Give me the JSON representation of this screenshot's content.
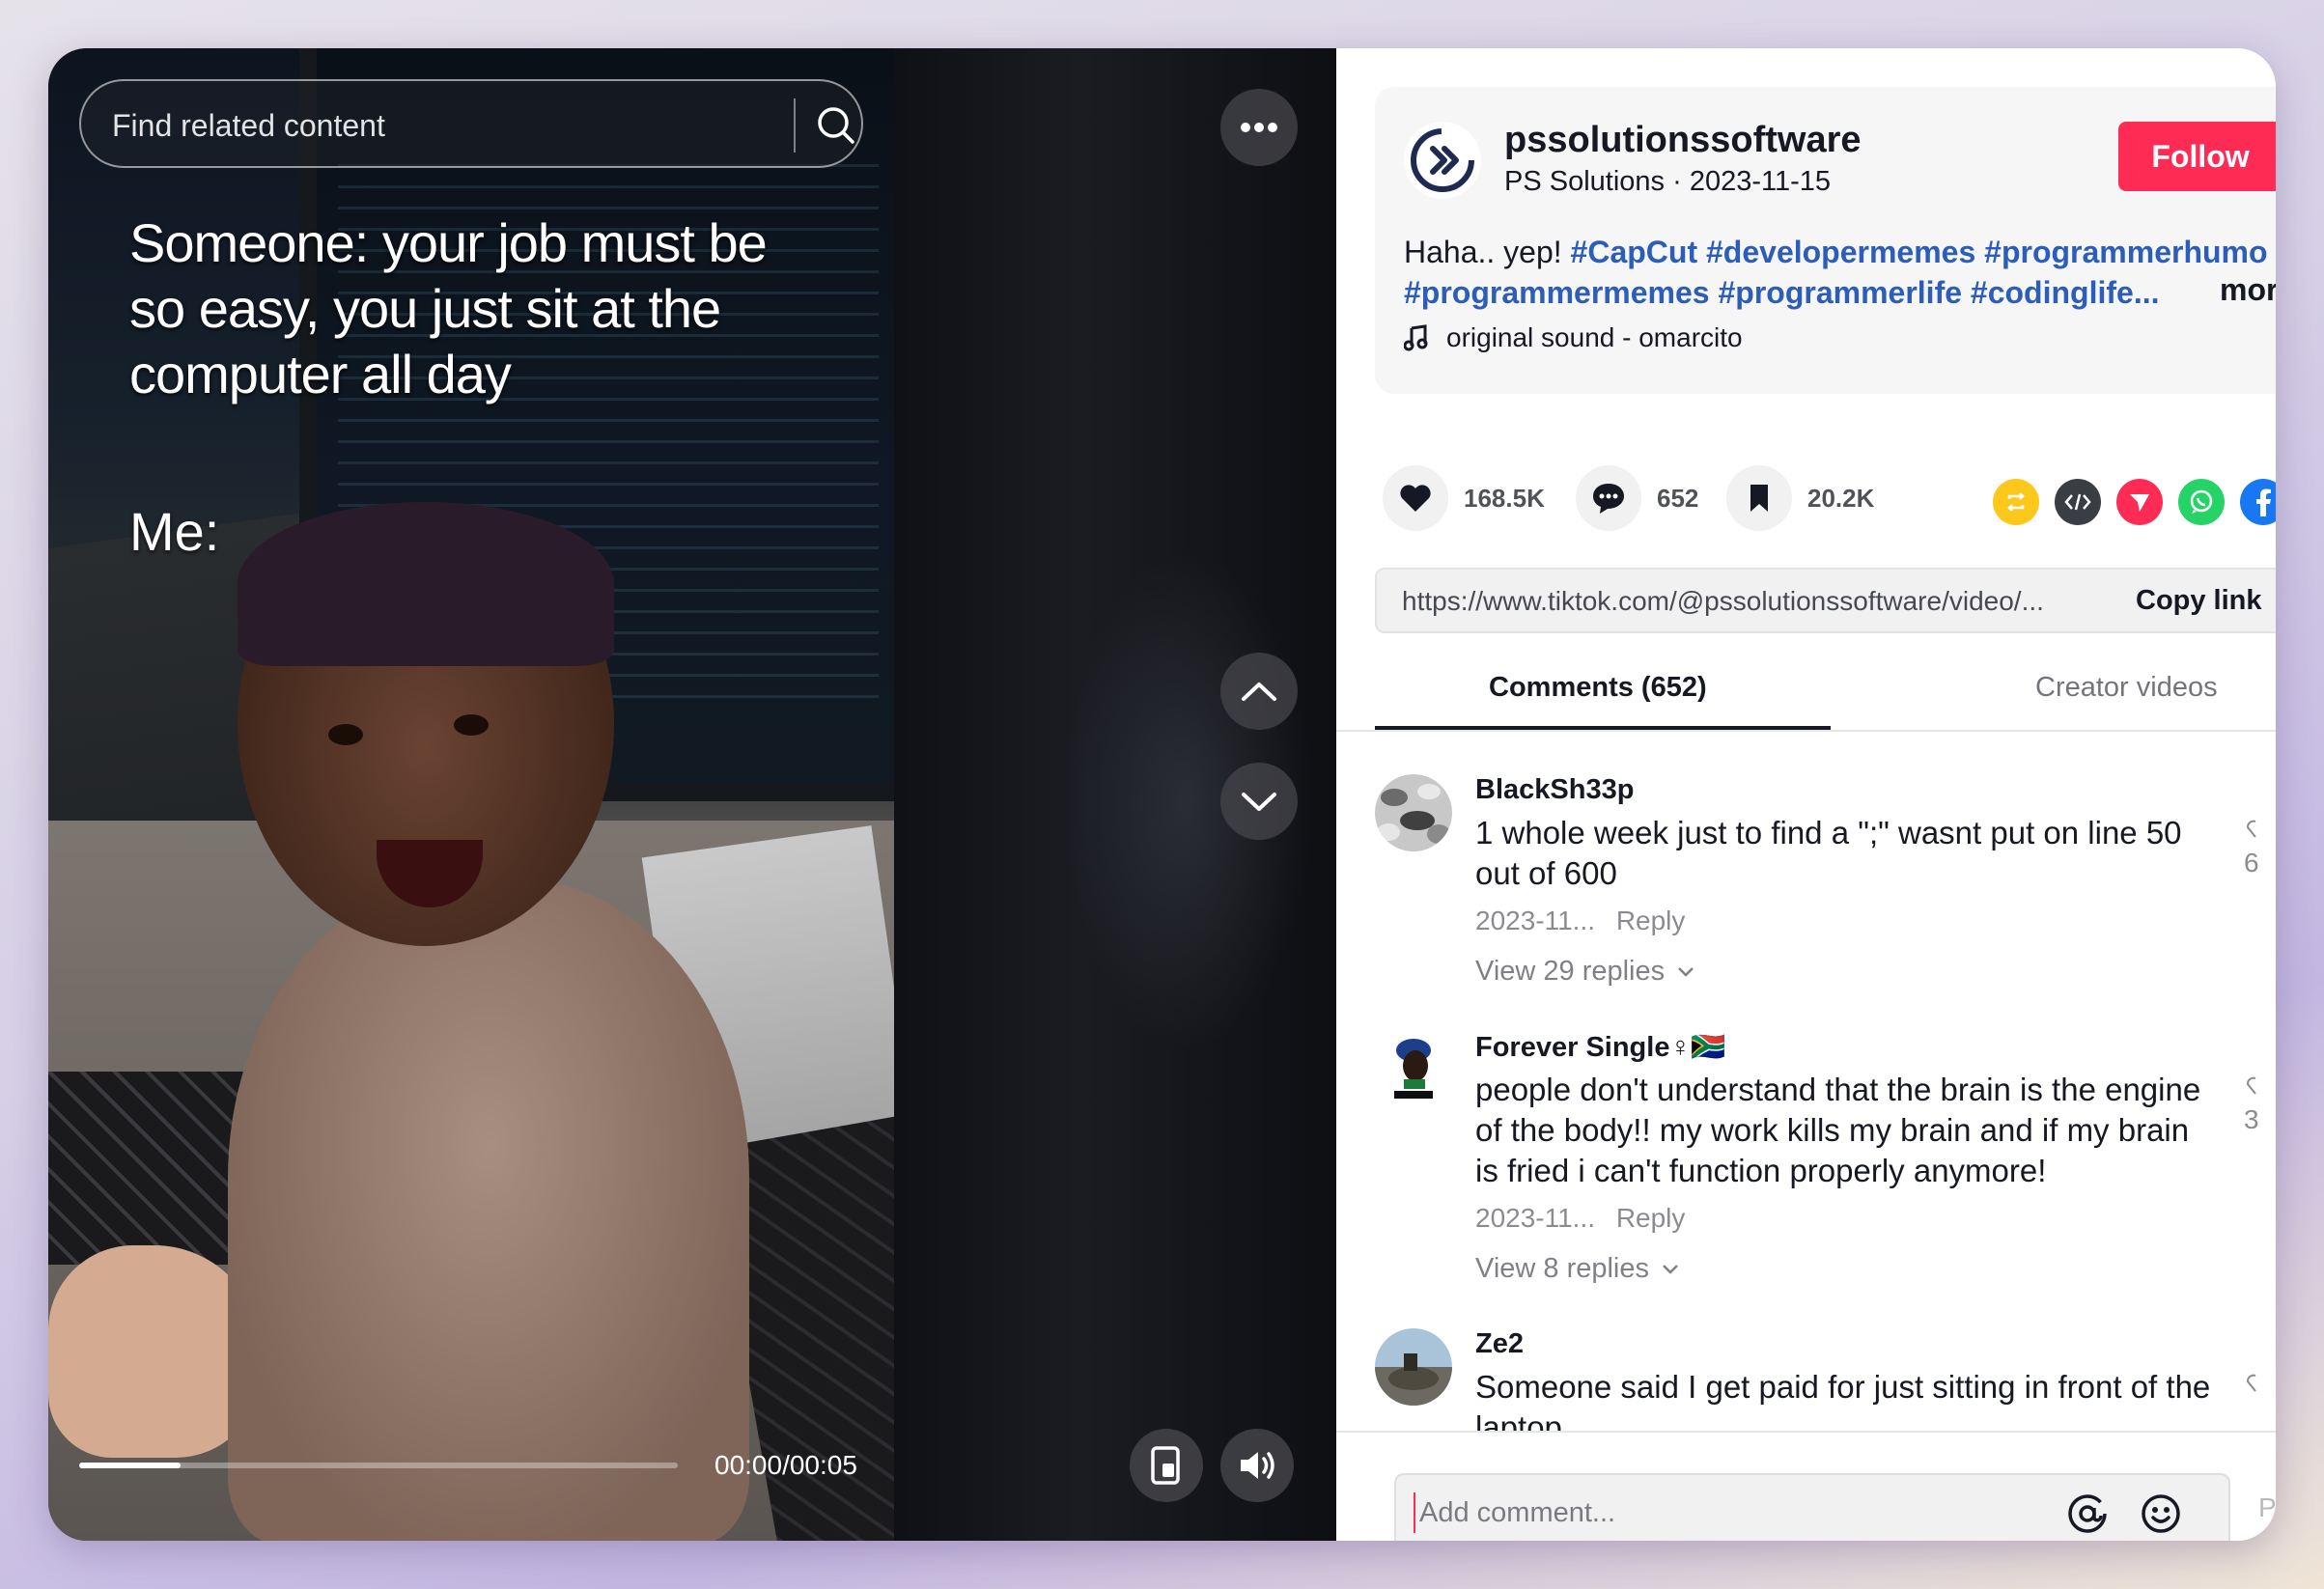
{
  "video": {
    "search_placeholder": "Find related content",
    "caption": "Someone: your job must be\nso easy, you just sit at the\ncomputer all day",
    "caption_me": "Me:",
    "time": "00:00/00:05",
    "progress": 0.17
  },
  "author": {
    "username": "pssolutionssoftware",
    "sub": "PS Solutions · 2023-11-15",
    "follow_label": "Follow"
  },
  "description": {
    "text": "Haha.. yep!",
    "tags_line1": [
      "#CapCut",
      "#developermemes",
      "#programmerhumo"
    ],
    "tags_line2": [
      "#programmermemes",
      "#programmerlife",
      "#codinglife..."
    ],
    "more_label": "more",
    "sound": "original sound - omarcito"
  },
  "stats": {
    "likes": "168.5K",
    "comments": "652",
    "saves": "20.2K"
  },
  "share": {
    "url": "https://www.tiktok.com/@pssolutionssoftware/video/...",
    "copy_label": "Copy link"
  },
  "tabs": {
    "comments": "Comments (652)",
    "creator": "Creator videos"
  },
  "comments": [
    {
      "user": "BlackSh33p",
      "text": "1 whole week just to find a \";\" wasnt put on line 50 out of 600",
      "date": "2023-11...",
      "reply": "Reply",
      "replies": "View 29 replies",
      "likes": "6"
    },
    {
      "user": "Forever Single♀🇿🇦",
      "text": "people don't understand that the brain is the engine of the body!! my work kills my brain and if my brain is fried i can't function properly anymore!",
      "date": "2023-11...",
      "reply": "Reply",
      "replies": "View 8 replies",
      "likes": "3"
    },
    {
      "user": "Ze2",
      "text": "Someone said I get paid for just sitting in front of the laptop",
      "date": "",
      "reply": "",
      "replies": "",
      "likes": ""
    }
  ],
  "comment_bar": {
    "placeholder": "Add comment...",
    "post_label": "P"
  },
  "colors": {
    "follow": "#fe2c55",
    "hashtag": "#2b5db9",
    "text": "#161823"
  }
}
